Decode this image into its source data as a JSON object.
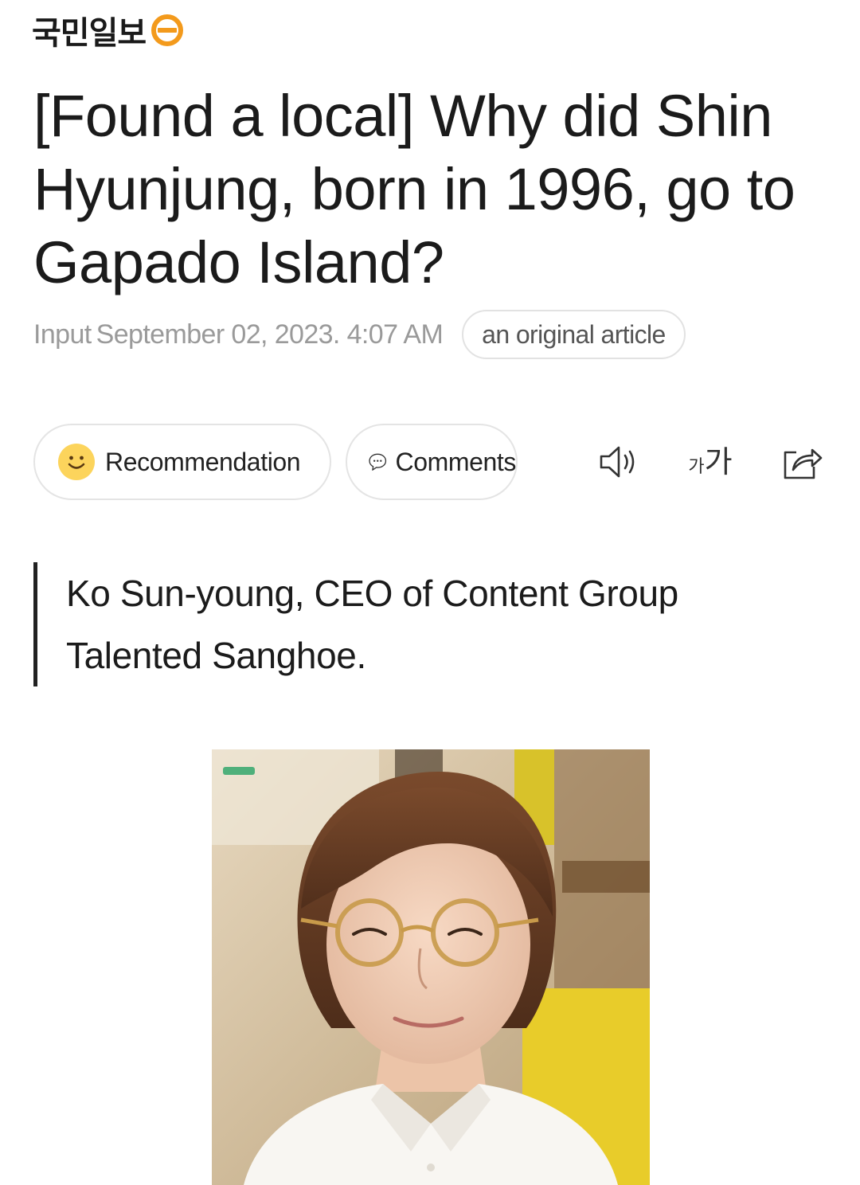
{
  "masthead": {
    "logo_text": "국민일보",
    "logo_icon": "kukmin-logo-icon",
    "brand_color": "#f39a1c"
  },
  "article": {
    "title": "[Found a local] Why did Shin Hyunjung, born in 1996, go to Gapado Island?",
    "input_label": "Input",
    "input_datetime": "September 02, 2023. 4:07 AM",
    "original_chip": "an original article",
    "subtitle_lines": [
      "Ko Sun-young, CEO of Content Group",
      "Talented Sanghoe."
    ]
  },
  "actions": {
    "recommend_label": "Recommendation",
    "recommend_icon": "smiley-face-icon",
    "comments_label": "Comments",
    "comments_icon": "speech-bubble-icon",
    "tts_icon": "speaker-icon",
    "font_size_icon": "font-size-icon",
    "font_size_small": "가",
    "font_size_large": "가",
    "share_icon": "share-icon"
  },
  "photo": {
    "subject": "portrait photo of a woman with short brown hair and round glasses"
  }
}
